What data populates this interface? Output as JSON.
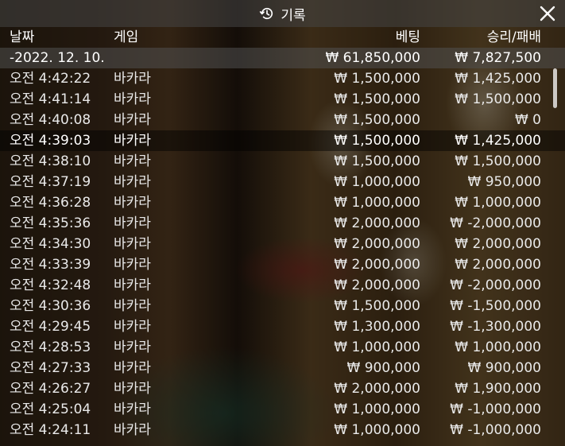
{
  "window": {
    "title": "기록",
    "history_icon": "history-icon",
    "close_icon": "close-icon"
  },
  "columns": {
    "date": "날짜",
    "game": "게임",
    "bet": "베팅",
    "win_loss": "승리/패배"
  },
  "summary": {
    "date": "-2022. 12. 10.",
    "bet": "₩ 61,850,000",
    "win_loss": "₩ 7,827,500"
  },
  "rows": [
    {
      "time": "오전 4:42:22",
      "game": "바카라",
      "bet": "₩ 1,500,000",
      "win_loss": "₩ 1,425,000"
    },
    {
      "time": "오전 4:41:14",
      "game": "바카라",
      "bet": "₩ 1,500,000",
      "win_loss": "₩ 1,500,000"
    },
    {
      "time": "오전 4:40:08",
      "game": "바카라",
      "bet": "₩ 1,500,000",
      "win_loss": "₩ 0"
    },
    {
      "time": "오전 4:39:03",
      "game": "바카라",
      "bet": "₩ 1,500,000",
      "win_loss": "₩ 1,425,000"
    },
    {
      "time": "오전 4:38:10",
      "game": "바카라",
      "bet": "₩ 1,500,000",
      "win_loss": "₩ 1,500,000"
    },
    {
      "time": "오전 4:37:19",
      "game": "바카라",
      "bet": "₩ 1,000,000",
      "win_loss": "₩ 950,000"
    },
    {
      "time": "오전 4:36:28",
      "game": "바카라",
      "bet": "₩ 1,000,000",
      "win_loss": "₩ 1,000,000"
    },
    {
      "time": "오전 4:35:36",
      "game": "바카라",
      "bet": "₩ 2,000,000",
      "win_loss": "₩ -2,000,000"
    },
    {
      "time": "오전 4:34:30",
      "game": "바카라",
      "bet": "₩ 2,000,000",
      "win_loss": "₩ 2,000,000"
    },
    {
      "time": "오전 4:33:39",
      "game": "바카라",
      "bet": "₩ 2,000,000",
      "win_loss": "₩ 2,000,000"
    },
    {
      "time": "오전 4:32:48",
      "game": "바카라",
      "bet": "₩ 2,000,000",
      "win_loss": "₩ -2,000,000"
    },
    {
      "time": "오전 4:30:36",
      "game": "바카라",
      "bet": "₩ 1,500,000",
      "win_loss": "₩ -1,500,000"
    },
    {
      "time": "오전 4:29:45",
      "game": "바카라",
      "bet": "₩ 1,300,000",
      "win_loss": "₩ -1,300,000"
    },
    {
      "time": "오전 4:28:53",
      "game": "바카라",
      "bet": "₩ 1,000,000",
      "win_loss": "₩ 1,000,000"
    },
    {
      "time": "오전 4:27:33",
      "game": "바카라",
      "bet": "₩ 900,000",
      "win_loss": "₩ 900,000"
    },
    {
      "time": "오전 4:26:27",
      "game": "바카라",
      "bet": "₩ 2,000,000",
      "win_loss": "₩ 1,900,000"
    },
    {
      "time": "오전 4:25:04",
      "game": "바카라",
      "bet": "₩ 1,000,000",
      "win_loss": "₩ -1,000,000"
    },
    {
      "time": "오전 4:24:11",
      "game": "바카라",
      "bet": "₩ 1,000,000",
      "win_loss": "₩ -1,000,000"
    }
  ],
  "colors": {
    "text": "#ffffff",
    "row_text": "#e9e9e9",
    "header_bg": "#464646"
  }
}
